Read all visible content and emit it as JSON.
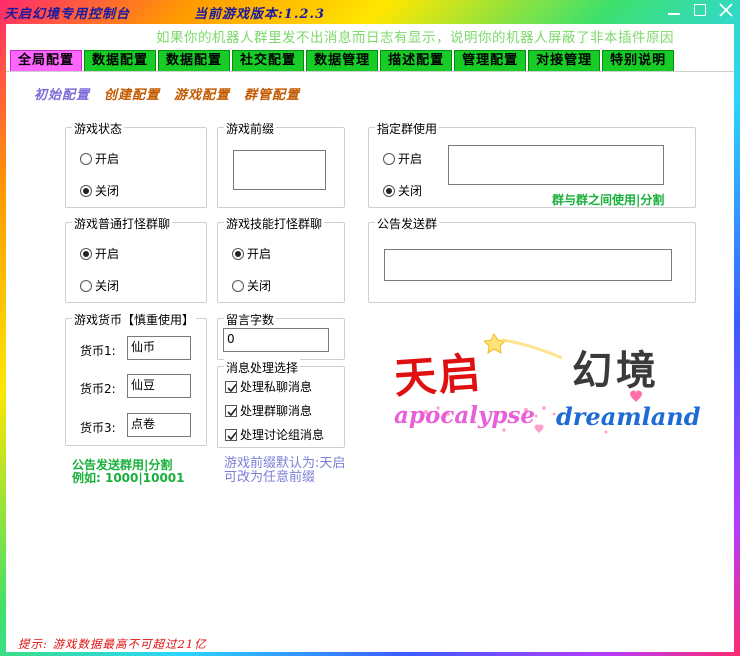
{
  "window": {
    "title": "天启幻境专用控制台",
    "version": "当前游戏版本:1.2.3"
  },
  "notice": "如果你的机器人群里发不出消息而日志有显示，说明你的机器人屏蔽了非本插件原因",
  "tabs": [
    {
      "label": "全局配置",
      "active": true
    },
    {
      "label": "数据配置",
      "active": false
    },
    {
      "label": "数据配置",
      "active": false
    },
    {
      "label": "社交配置",
      "active": false
    },
    {
      "label": "数据管理",
      "active": false
    },
    {
      "label": "描述配置",
      "active": false
    },
    {
      "label": "管理配置",
      "active": false
    },
    {
      "label": "对接管理",
      "active": false
    },
    {
      "label": "特别说明",
      "active": false
    }
  ],
  "subtabs": [
    {
      "label": "初始配置",
      "active": true
    },
    {
      "label": "创建配置",
      "active": false
    },
    {
      "label": "游戏配置",
      "active": false
    },
    {
      "label": "群管配置",
      "active": false
    }
  ],
  "game_status": {
    "title": "游戏状态",
    "on": "开启",
    "off": "关闭",
    "selected": "off"
  },
  "game_prefix": {
    "title": "游戏前缀",
    "value": ""
  },
  "designated_group": {
    "title": "指定群使用",
    "on": "开启",
    "off": "关闭",
    "selected": "off",
    "value": "",
    "hint": "群与群之间使用|分割"
  },
  "normal_fight": {
    "title": "游戏普通打怪群聊",
    "on": "开启",
    "off": "关闭",
    "selected": "on"
  },
  "skill_fight": {
    "title": "游戏技能打怪群聊",
    "on": "开启",
    "off": "关闭",
    "selected": "on"
  },
  "announce_group": {
    "title": "公告发送群",
    "value": ""
  },
  "currency": {
    "title": "游戏货币【慎重使用】",
    "items": [
      {
        "label": "货币1:",
        "value": "仙币"
      },
      {
        "label": "货币2:",
        "value": "仙豆"
      },
      {
        "label": "货币3:",
        "value": "点卷"
      }
    ]
  },
  "message_length": {
    "title": "留言字数",
    "value": "0"
  },
  "message_handling": {
    "title": "消息处理选择",
    "options": [
      {
        "label": "处理私聊消息",
        "checked": true
      },
      {
        "label": "处理群聊消息",
        "checked": true
      },
      {
        "label": "处理讨论组消息",
        "checked": true
      }
    ]
  },
  "hints": {
    "announce_line1": "公告发送群用|分割",
    "announce_line2": "例如: 1000|10001",
    "prefix_line1": "游戏前缀默认为:天启",
    "prefix_line2": "可改为任意前缀"
  },
  "logo": {
    "cn_left": "天启",
    "cn_right": "幻境",
    "en_left": "apocalypse",
    "en_right": "dreamland"
  },
  "footer": "提示: 游戏数据最高不可超过21亿",
  "colors": {
    "tab_active": "#ff66ff",
    "tab_inactive": "#18cc28",
    "subtab_active": "#7b6dd8",
    "subtab": "#c45a00",
    "hint_green": "#17b03a",
    "hint_blue": "#7b7fd6",
    "notice": "#7dd96a",
    "footer": "#e01010",
    "logo_red": "#e01010",
    "logo_pink": "#e85fd8",
    "logo_blue": "#1f6bd6"
  }
}
